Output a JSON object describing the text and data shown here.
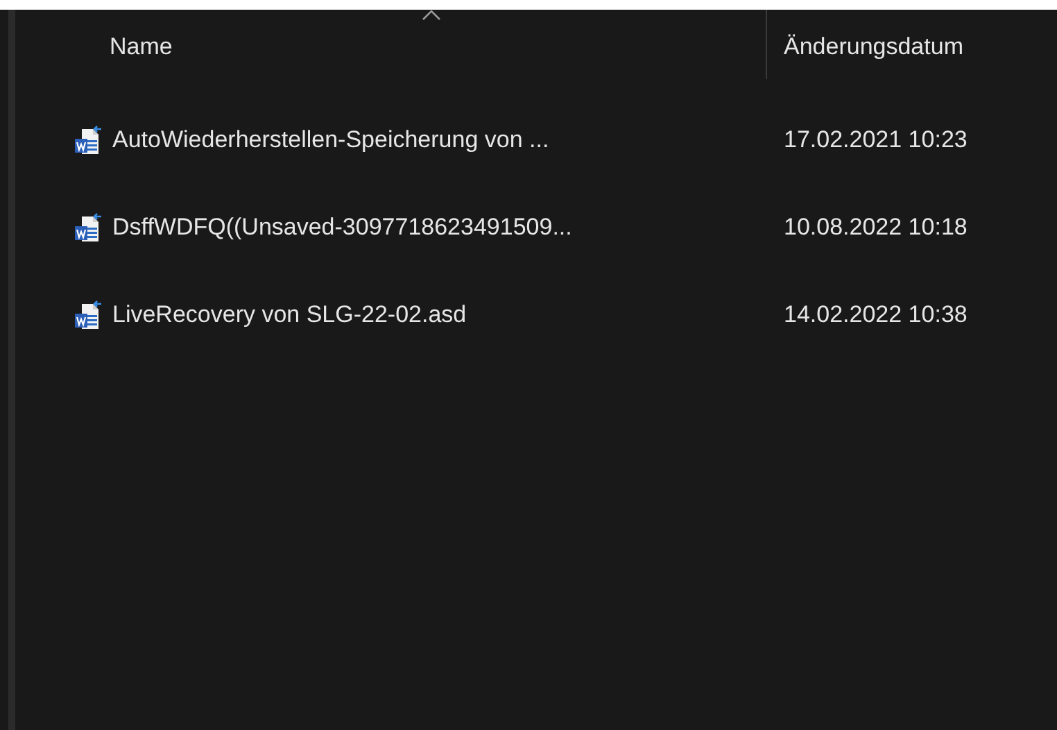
{
  "columns": [
    {
      "label": "Name",
      "sorted": true
    },
    {
      "label": "Änderungsdatum",
      "sorted": false
    }
  ],
  "files": [
    {
      "name": "AutoWiederherstellen-Speicherung von ...",
      "modified": "17.02.2021 10:23"
    },
    {
      "name": "DsffWDFQ((Unsaved-3097718623491509...",
      "modified": "10.08.2022 10:18"
    },
    {
      "name": "LiveRecovery von SLG-22-02.asd",
      "modified": "14.02.2022 10:38"
    }
  ]
}
